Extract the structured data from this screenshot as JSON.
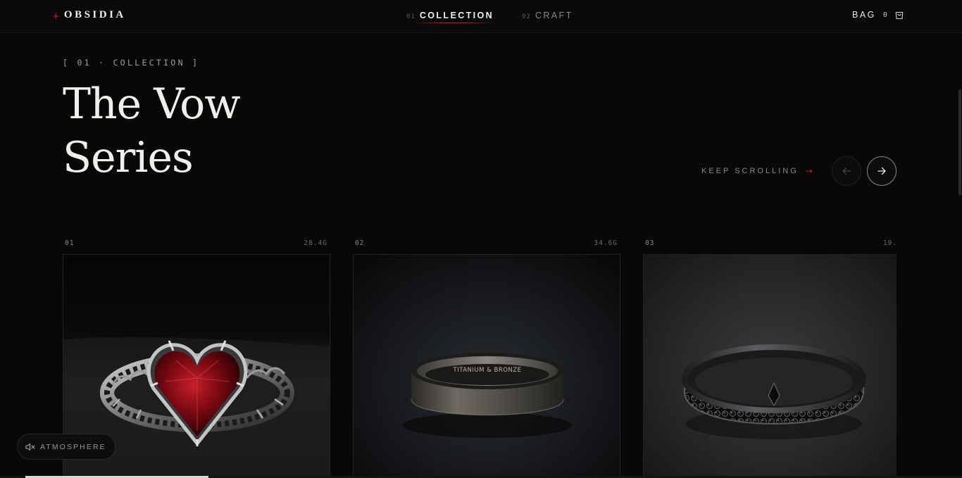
{
  "header": {
    "logo": {
      "mark": "+",
      "name": "OBSIDIA"
    },
    "nav": [
      {
        "num": "01",
        "label": "COLLECTION",
        "active": true
      },
      {
        "num": "02",
        "label": "CRAFT",
        "active": false
      }
    ],
    "bag": {
      "label": "BAG",
      "count": "0",
      "icon": "bag-icon"
    }
  },
  "section": {
    "eyebrow": "[ 01 · COLLECTION ]",
    "title_line1": "The Vow",
    "title_line2": "Series",
    "keep_scrolling": "KEEP SCROLLING",
    "keep_arrow": "→",
    "prev_icon": "arrow-left-icon",
    "next_icon": "arrow-right-icon"
  },
  "products": [
    {
      "index": "01",
      "weight": "28.4G",
      "subject": "ruby heart ring with ornate silver thorn band"
    },
    {
      "index": "02",
      "weight": "34.6G",
      "subject": "brushed titanium and bronze band",
      "engraving": "TITANIUM & BRONZE"
    },
    {
      "index": "03",
      "weight": "19.",
      "subject": "black pavé gemstone eternity band"
    }
  ],
  "atmosphere": {
    "label": "ATMOSPHERE",
    "icon": "speaker-muted-icon"
  },
  "colors": {
    "accent": "#d4141e",
    "background": "#080808",
    "text": "#f2eee9"
  },
  "scroll_progress": 0.19
}
